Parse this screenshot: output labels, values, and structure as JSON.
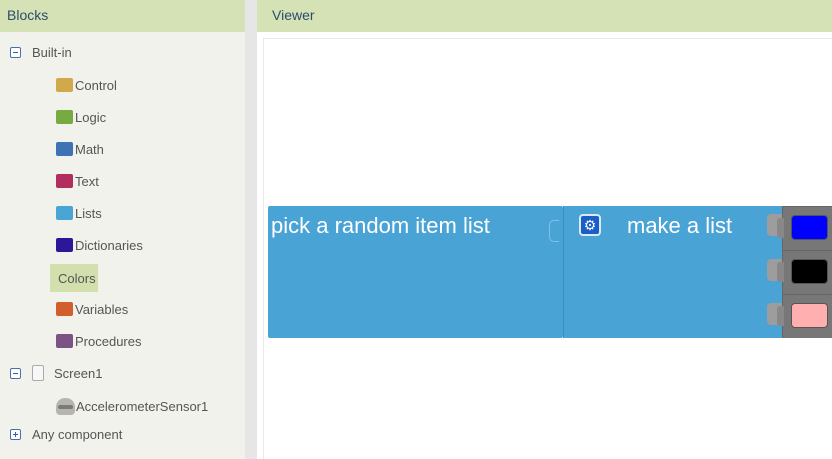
{
  "blocks_panel": {
    "title": "Blocks",
    "builtin": {
      "label": "Built-in",
      "items": [
        {
          "label": "Control",
          "color": "#d1a94a"
        },
        {
          "label": "Logic",
          "color": "#77ab41"
        },
        {
          "label": "Math",
          "color": "#3f71b5"
        },
        {
          "label": "Text",
          "color": "#b32d5e"
        },
        {
          "label": "Lists",
          "color": "#49a6d4"
        },
        {
          "label": "Dictionaries",
          "color": "#2d1799"
        },
        {
          "label": "Colors",
          "color": "#7d7d7d"
        },
        {
          "label": "Variables",
          "color": "#d05f2d"
        },
        {
          "label": "Procedures",
          "color": "#7c5385"
        }
      ],
      "selected": "Colors"
    },
    "screen": {
      "label": "Screen1",
      "components": [
        {
          "label": "AccelerometerSensor1",
          "icon": "accelerometer-icon"
        }
      ]
    },
    "any_component": {
      "label": "Any component"
    }
  },
  "viewer": {
    "title": "Viewer",
    "pick_block": {
      "label": "pick a random item  list"
    },
    "make_list_block": {
      "label": "make a list",
      "mutator_icon": "gear-icon"
    },
    "list_items": [
      {
        "color": "#0000ff"
      },
      {
        "color": "#000000"
      },
      {
        "color": "#ffafaf"
      }
    ]
  }
}
